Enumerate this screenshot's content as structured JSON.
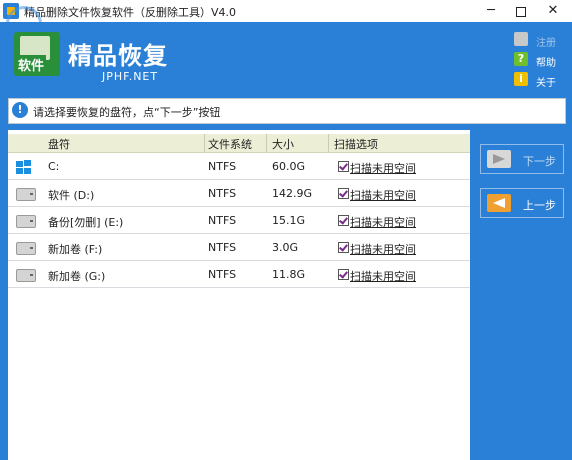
{
  "window": {
    "title": "精品删除文件恢复软件（反删除工具）V4.0",
    "controls": {
      "minimize": "─",
      "close": "✕"
    }
  },
  "watermark": "河东软件园",
  "header": {
    "logo_badge": "软件",
    "title": "精品恢复",
    "subtitle": "JPHF.NET",
    "links": [
      {
        "label": "注册",
        "icon": "cart-icon"
      },
      {
        "label": "帮助",
        "icon": "help-icon",
        "glyph": "?"
      },
      {
        "label": "关于",
        "icon": "info-icon",
        "glyph": "i"
      }
    ]
  },
  "instruction": {
    "icon_glyph": "!",
    "text": "请选择要恢复的盘符，点“下一步”按钮"
  },
  "table": {
    "columns": [
      "盘符",
      "文件系统",
      "大小",
      "扫描选项"
    ],
    "rows": [
      {
        "name": "C:",
        "fs": "NTFS",
        "size": "60.0G",
        "option": "扫描未用空间",
        "icon": "windows-drive-icon",
        "checked": true
      },
      {
        "name": "软件 (D:)",
        "fs": "NTFS",
        "size": "142.9G",
        "option": "扫描未用空间",
        "icon": "drive-icon",
        "checked": true
      },
      {
        "name": "备份[勿删] (E:)",
        "fs": "NTFS",
        "size": "15.1G",
        "option": "扫描未用空间",
        "icon": "drive-icon",
        "checked": true
      },
      {
        "name": "新加卷 (F:)",
        "fs": "NTFS",
        "size": "3.0G",
        "option": "扫描未用空间",
        "icon": "drive-icon",
        "checked": true
      },
      {
        "name": "新加卷 (G:)",
        "fs": "NTFS",
        "size": "11.8G",
        "option": "扫描未用空间",
        "icon": "drive-icon",
        "checked": true
      }
    ]
  },
  "nav": {
    "next_label": "下一步",
    "prev_label": "上一步"
  },
  "colors": {
    "background": "#2a7fd6",
    "header_row": "#ecefd6",
    "prev_arrow": "#f0a030"
  }
}
